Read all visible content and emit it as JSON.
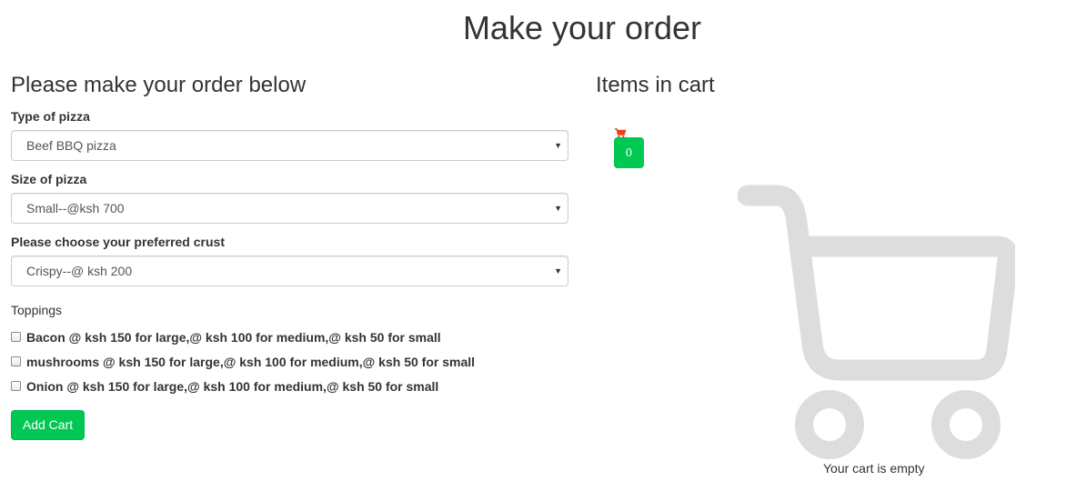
{
  "page": {
    "title": "Make your order"
  },
  "order_form": {
    "heading": "Please make your order below",
    "pizza_type": {
      "label": "Type of pizza",
      "selected": "Beef BBQ pizza"
    },
    "pizza_size": {
      "label": "Size of pizza",
      "selected": "Small--@ksh 700"
    },
    "crust": {
      "label": "Please choose your preferred crust",
      "selected": "Crispy--@ ksh 200"
    },
    "toppings_label": "Toppings",
    "toppings": [
      {
        "label": "Bacon @ ksh 150 for large,@ ksh 100 for medium,@ ksh 50 for small",
        "checked": false
      },
      {
        "label": "mushrooms @ ksh 150 for large,@ ksh 100 for medium,@ ksh 50 for small",
        "checked": false
      },
      {
        "label": "Onion @ ksh 150 for large,@ ksh 100 for medium,@ ksh 50 for small",
        "checked": false
      }
    ],
    "add_button": "Add Cart"
  },
  "cart": {
    "heading": "Items in cart",
    "count": "0",
    "empty_text": "Your cart is empty",
    "icon": "shopping-cart-icon",
    "accent_color": "#00c853",
    "mini_icon_color": "#e8401c",
    "big_icon_color": "#dddddd"
  }
}
